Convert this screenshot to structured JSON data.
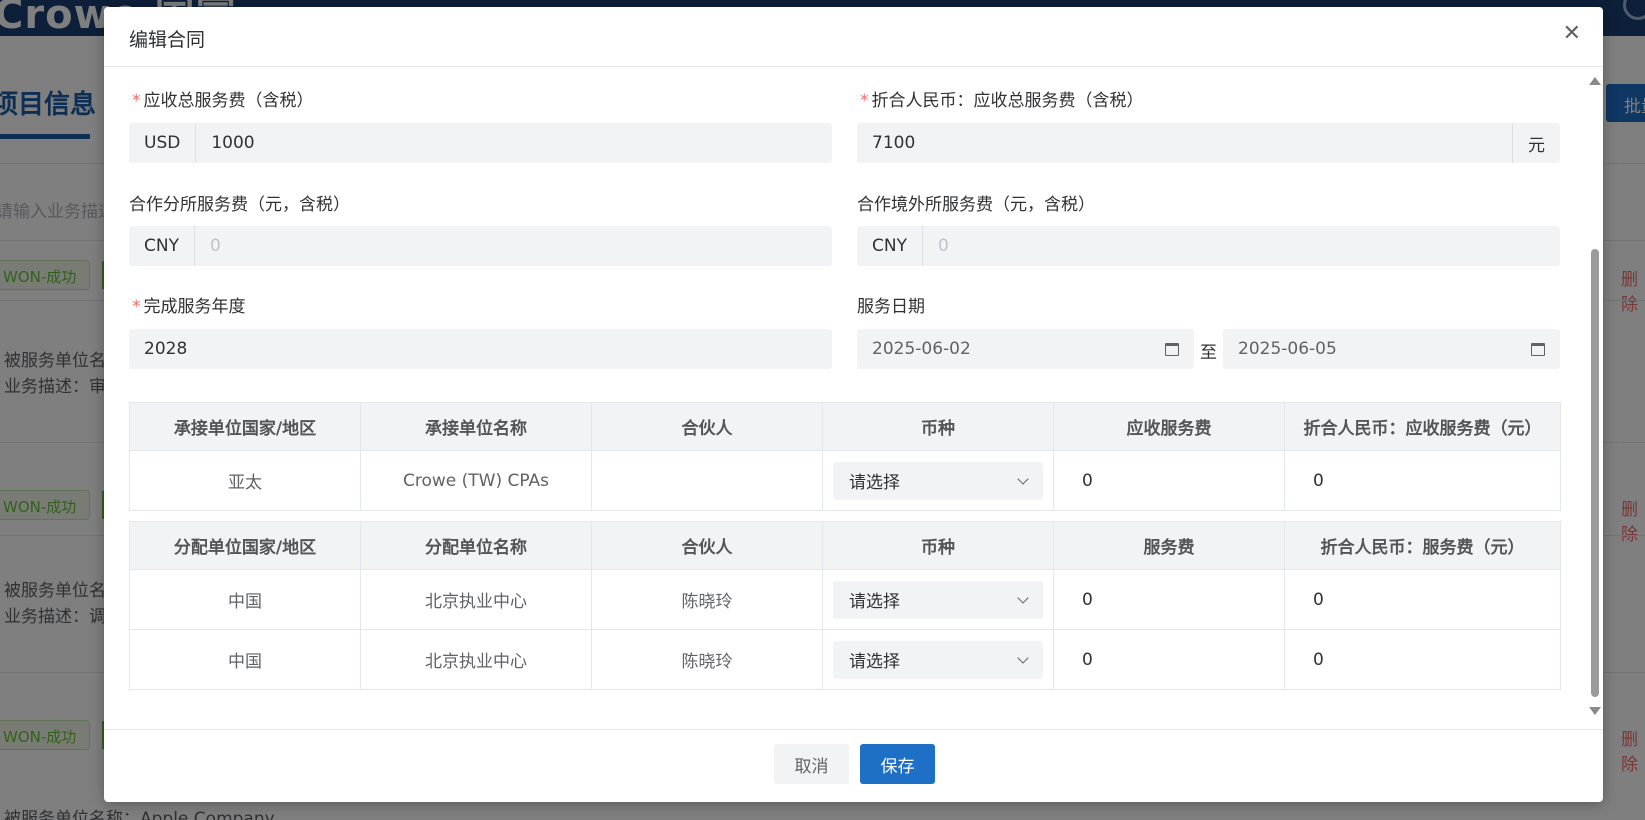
{
  "background": {
    "logo": "Crowe 国富",
    "section_title": "项目信息",
    "search_placeholder": "请输入业务描述",
    "batch_button": "批量",
    "status_tag": "WON-成功",
    "delete_label": "删除",
    "rows": [
      {
        "line1": "被服务单位名称：",
        "line2": "业务描述：审"
      },
      {
        "line1": "被服务单位名",
        "line2": "业务描述：调"
      },
      {
        "line1": "被服务单位名称：Apple Company",
        "line2": ""
      }
    ]
  },
  "dialog": {
    "title": "编辑合同",
    "close_icon": "close-icon",
    "fields": {
      "receivable_total": {
        "label": "应收总服务费（含税）",
        "required": true,
        "currency": "USD",
        "value": "1000"
      },
      "rmb_total": {
        "label": "折合人民币：应收总服务费（含税）",
        "required": true,
        "value": "7100",
        "unit": "元"
      },
      "branch_fee": {
        "label": "合作分所服务费（元，含税）",
        "currency": "CNY",
        "placeholder": "0"
      },
      "overseas_fee": {
        "label": "合作境外所服务费（元，含税）",
        "currency": "CNY",
        "placeholder": "0"
      },
      "service_year": {
        "label": "完成服务年度",
        "required": true,
        "value": "2028"
      },
      "service_date": {
        "label": "服务日期",
        "start": "2025-06-02",
        "separator": "至",
        "end": "2025-06-05"
      }
    },
    "undertake_table": {
      "headers": [
        "承接单位国家/地区",
        "承接单位名称",
        "合伙人",
        "币种",
        "应收服务费",
        "折合人民币：应收服务费（元）"
      ],
      "rows": [
        {
          "region": "亚太",
          "name": "Crowe (TW) CPAs",
          "partner": "",
          "currency": "请选择",
          "fee": "0",
          "rmb": "0"
        }
      ]
    },
    "allocate_table": {
      "headers": [
        "分配单位国家/地区",
        "分配单位名称",
        "合伙人",
        "币种",
        "服务费",
        "折合人民币：服务费（元）"
      ],
      "rows": [
        {
          "region": "中国",
          "name": "北京执业中心",
          "partner": "陈晓玲",
          "currency": "请选择",
          "fee": "0",
          "rmb": "0"
        },
        {
          "region": "中国",
          "name": "北京执业中心",
          "partner": "陈晓玲",
          "currency": "请选择",
          "fee": "0",
          "rmb": "0"
        }
      ]
    },
    "footer": {
      "cancel": "取消",
      "save": "保存"
    }
  }
}
